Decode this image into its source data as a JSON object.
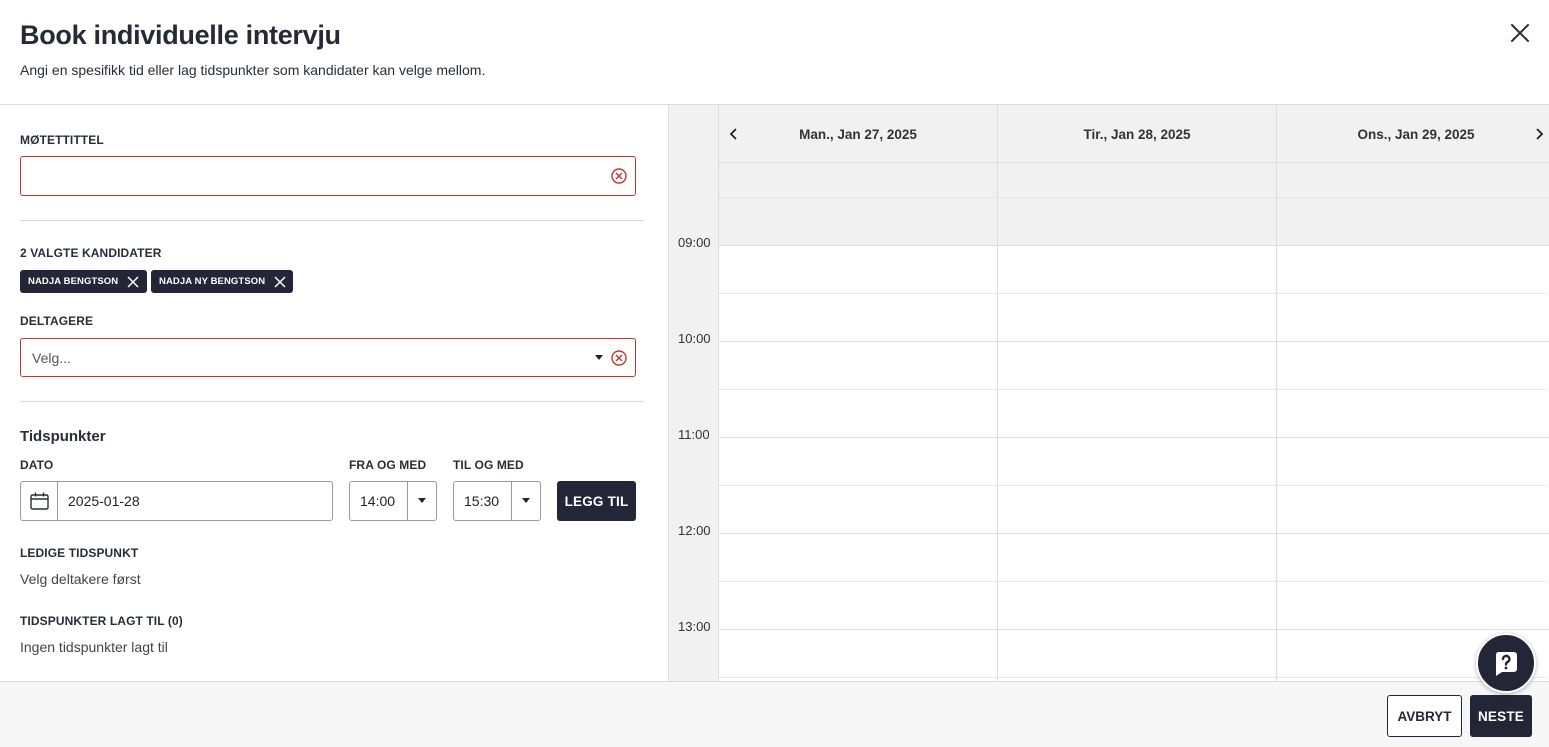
{
  "header": {
    "title": "Book individuelle intervju",
    "subtitle": "Angi en spesifikk tid eller lag tidspunkter som kandidater kan velge mellom."
  },
  "form": {
    "meeting_title_label": "MØTETTITTEL",
    "meeting_title_value": "",
    "candidates_label": "2 VALGTE KANDIDATER",
    "candidates": [
      {
        "name": "NADJA BENGTSON"
      },
      {
        "name": "NADJA NY BENGTSON"
      }
    ],
    "participants_label": "DELTAGERE",
    "participants_placeholder": "Velg...",
    "timeslots_title": "Tidspunkter",
    "date_label": "DATO",
    "date_value": "2025-01-28",
    "from_label": "FRA OG MED",
    "from_value": "14:00",
    "to_label": "TIL OG MED",
    "to_value": "15:30",
    "add_button": "LEGG TIL",
    "available_label": "LEDIGE TIDSPUNKT",
    "available_text": "Velg deltakere først",
    "added_label": "TIDSPUNKTER LAGT TIL (0)",
    "added_text": "Ingen tidspunkter lagt til"
  },
  "calendar": {
    "days": [
      "Man., Jan 27, 2025",
      "Tir., Jan 28, 2025",
      "Ons., Jan 29, 2025"
    ],
    "hours": [
      "09:00",
      "10:00",
      "11:00",
      "12:00",
      "13:00"
    ]
  },
  "footer": {
    "cancel": "AVBRYT",
    "next": "NESTE"
  },
  "colors": {
    "primary_dark": "#232636",
    "error_red": "#c0392b",
    "calendar_shade": "#f1f1f1"
  },
  "icons": {
    "close": "close-icon",
    "clear": "clear-circle-icon",
    "calendar": "calendar-icon",
    "help": "help-chat-icon"
  }
}
